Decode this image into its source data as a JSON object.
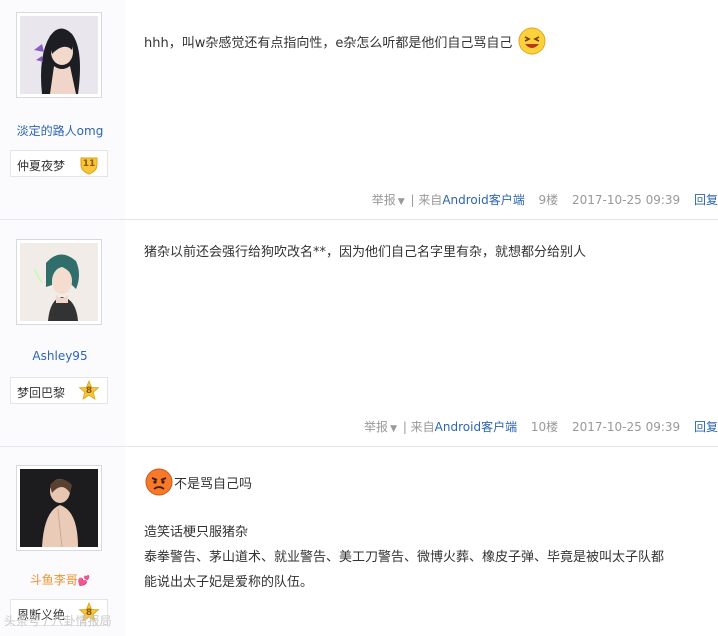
{
  "posts": [
    {
      "username": "淡定的路人omg",
      "level_title": "仲夏夜梦",
      "level": "11",
      "content_lines": [
        "hhh，叫w杂感觉还有点指向性，e杂怎么听都是他们自己骂自己"
      ],
      "report": "举报",
      "source_prefix": "| 来自",
      "client": "Android客户端",
      "floor": "9楼",
      "time": "2017-10-25 09:39",
      "reply": "回复"
    },
    {
      "username": "Ashley95",
      "level_title": "梦回巴黎",
      "level": "8",
      "content_lines": [
        "猪杂以前还会强行给狗吹改名**，因为他们自己名字里有杂，就想都分给别人"
      ],
      "report": "举报",
      "source_prefix": "| 来自",
      "client": "Android客户端",
      "floor": "10楼",
      "time": "2017-10-25 09:39",
      "reply": "回复"
    },
    {
      "username": "斗鱼李哥",
      "level_title": "恩断义绝",
      "level": "8",
      "quote_line": "不是骂自己吗",
      "content_lines": [
        "造笑话梗只服猪杂",
        "泰拳警告、茅山道术、就业警告、美工刀警告、微博火葬、橡皮子弹、毕竟是被叫太子队都",
        "能说出太子妃是爱称的队伍。"
      ]
    }
  ],
  "watermark": "头条号 / 八卦情报局",
  "colors": {
    "link": "#2d64b3",
    "muted": "#999999",
    "orange_name": "#f2902e",
    "badge": "#f7c43b"
  },
  "icons": [
    "avatar",
    "level-badge-icon",
    "laugh-emoji-icon",
    "angry-emoji-icon",
    "caret-down-icon",
    "heart-icon"
  ]
}
